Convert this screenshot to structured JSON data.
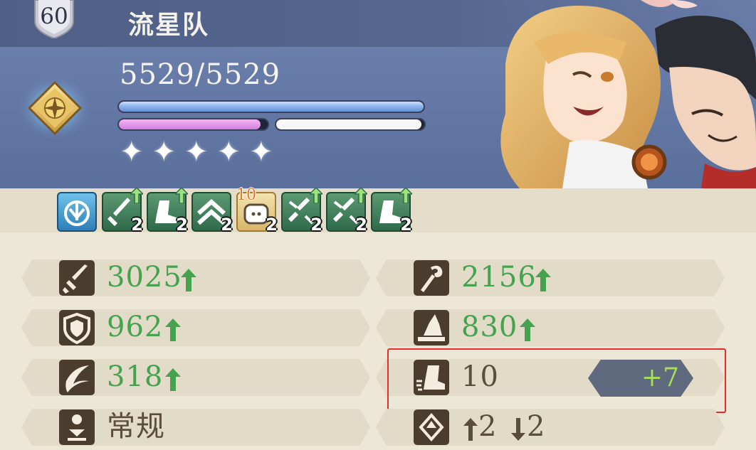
{
  "header": {
    "level": "60",
    "team_name": "流星队",
    "hp_text": "5529/5529",
    "hp_fraction": 1.0,
    "mp_fraction": 0.95,
    "ex_fraction": 0.98,
    "star_count": 5,
    "star_glyph": "✦"
  },
  "skills": [
    {
      "icon": "ice-burst-icon",
      "count": "",
      "upgrade": false,
      "style": "blue"
    },
    {
      "icon": "sword-up-icon",
      "count": "2",
      "upgrade": true,
      "style": "green"
    },
    {
      "icon": "boot-up-icon",
      "count": "2",
      "upgrade": true,
      "style": "green"
    },
    {
      "icon": "chevrons-up-icon",
      "count": "2",
      "upgrade": false,
      "style": "green"
    },
    {
      "icon": "heal-bag-icon",
      "count": "2",
      "upgrade": false,
      "style": "gold",
      "top_count": "10"
    },
    {
      "icon": "broken-sword-up-icon",
      "count": "2",
      "upgrade": true,
      "style": "green"
    },
    {
      "icon": "broken-sword-up-icon",
      "count": "2",
      "upgrade": true,
      "style": "green"
    },
    {
      "icon": "boot-up-icon",
      "count": "2",
      "upgrade": true,
      "style": "green"
    }
  ],
  "stats": {
    "attack": "3025",
    "magic_attack": "2156",
    "defense": "962",
    "magic_defense": "830",
    "evasion": "318",
    "speed": "10",
    "speed_bonus": "+7",
    "movement_type": "常规",
    "jump_up": "2",
    "jump_down": "2"
  },
  "colors": {
    "buff_green": "#45a24e",
    "bonus_green": "#a8e05a",
    "highlight_red": "#e82c2c",
    "header_blue": "#6478a6"
  }
}
